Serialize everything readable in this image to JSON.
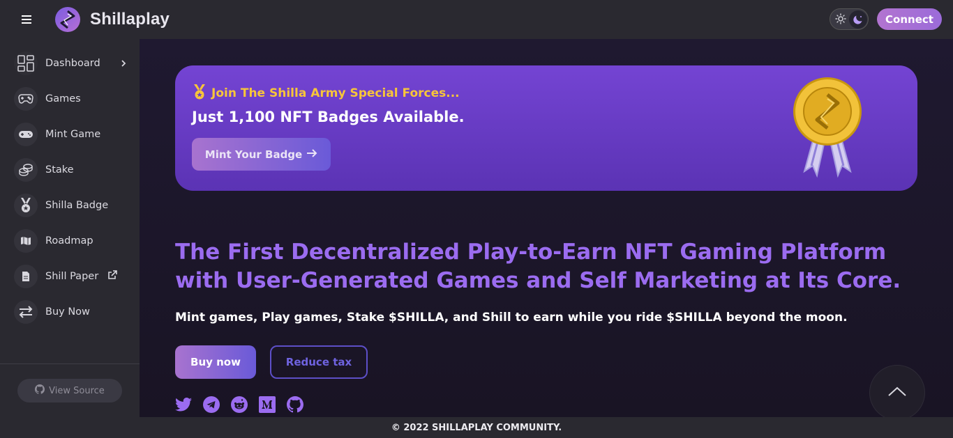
{
  "header": {
    "brand": "Shillaplay",
    "connect_label": "Connect"
  },
  "sidebar": {
    "items": [
      {
        "label": "Dashboard",
        "icon": "dashboard-icon"
      },
      {
        "label": "Games",
        "icon": "gamepad-icon"
      },
      {
        "label": "Mint Game",
        "icon": "controller-icon"
      },
      {
        "label": "Stake",
        "icon": "coins-icon"
      },
      {
        "label": "Shilla Badge",
        "icon": "medal-icon"
      },
      {
        "label": "Roadmap",
        "icon": "map-icon"
      },
      {
        "label": "Shill Paper",
        "icon": "document-icon"
      },
      {
        "label": "Buy Now",
        "icon": "exchange-icon"
      }
    ],
    "view_source": "View Source"
  },
  "banner": {
    "kicker": "Join The Shilla Army Special Forces...",
    "title": "Just 1,100 NFT Badges Available.",
    "cta": "Mint Your Badge"
  },
  "hero": {
    "title": "The First Decentralized Play-to-Earn NFT Gaming Platform with User-Generated Games and Self Marketing at Its Core.",
    "subtitle": "Mint games, Play games, Stake $SHILLA, and Shill to earn while you ride $SHILLA beyond the moon.",
    "buy_label": "Buy now",
    "reduce_label": "Reduce tax"
  },
  "socials": [
    "twitter-icon",
    "telegram-icon",
    "reddit-icon",
    "medium-icon",
    "github-icon"
  ],
  "footer": {
    "text": "© 2022 SHILLAPLAY COMMUNITY."
  },
  "colors": {
    "accent": "#9b6cf0",
    "banner": "#7444d3",
    "gold": "#f7c53a"
  }
}
